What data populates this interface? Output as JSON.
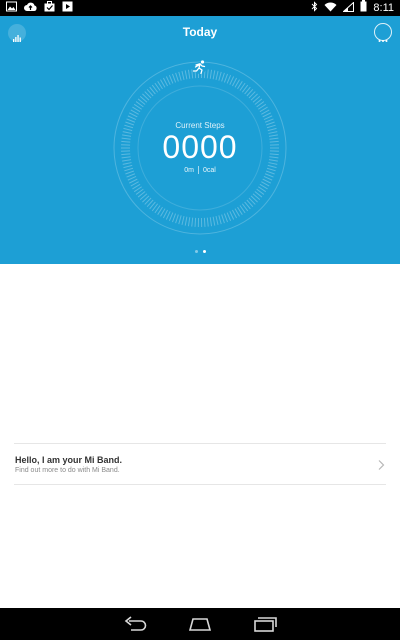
{
  "status_bar": {
    "time": "8:11",
    "left_icons": [
      "image-icon",
      "cloud-upload-icon",
      "briefcase-icon",
      "play-icon"
    ],
    "right_icons": [
      "bluetooth-icon",
      "wifi-icon",
      "signal-icon",
      "battery-icon"
    ]
  },
  "header": {
    "title": "Today",
    "left_icon": "bar-chart-icon",
    "right_icon": "more-icon"
  },
  "steps": {
    "label": "Current Steps",
    "value": "0000",
    "distance": "0m",
    "calories": "0cal",
    "icon": "running-icon"
  },
  "pager": {
    "pages": 2,
    "active": 1
  },
  "band_card": {
    "title": "Hello, I am your Mi Band.",
    "subtitle": "Find out more to do with Mi Band.",
    "icon": "chevron-right-icon"
  },
  "nav_bar": {
    "icons": [
      "back-icon",
      "home-icon",
      "recent-apps-icon"
    ]
  },
  "colors": {
    "accent": "#1d9fd5",
    "background": "#ffffff",
    "bars": "#000000"
  }
}
